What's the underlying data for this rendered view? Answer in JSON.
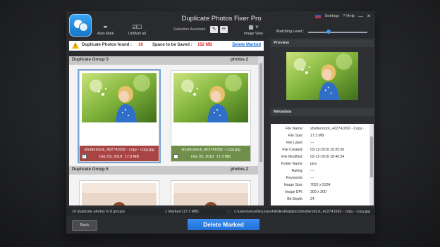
{
  "app": {
    "title": "Duplicate Photos Fixer Pro"
  },
  "topbar": {
    "settings": "Settings",
    "help": "? Help",
    "language": "EN"
  },
  "toolbar": {
    "auto_mark": "Auto Mark",
    "unmark_all": "UnMark all",
    "selection_assistant": "Selection Assistant",
    "image_view": "Image View",
    "matching_level": "Matching Level :"
  },
  "matching_level_fraction": 0.35,
  "info": {
    "found_label": "Duplicate Photos found :",
    "found_value": "16",
    "space_label": "Space to be Saved :",
    "space_value": "152 MB",
    "delete_link": "Delete Marked"
  },
  "groups": [
    {
      "name": "Duplicate Group 5",
      "count": "photos 2",
      "photos": [
        {
          "filename": "shutterstock_422741692 - copy - copy.jpg",
          "date": "Dec 03, 2019",
          "size": "17.3 MB",
          "checked": "✓",
          "status": "marked"
        },
        {
          "filename": "shutterstock_422741692 - copy.jpg",
          "date": "Dec 03, 2019",
          "size": "17.3 MB",
          "checked": "",
          "status": "kept"
        }
      ]
    },
    {
      "name": "Duplicate Group 6",
      "count": "photos 2"
    }
  ],
  "panels": {
    "preview": "Preview",
    "metadata": "Metadata"
  },
  "metadata": [
    {
      "k": "File Name:",
      "v": "shutterstock_422741692 - Copy - Copy.jpg"
    },
    {
      "k": "File Size:",
      "v": "17.3 MB"
    },
    {
      "k": "File Label:",
      "v": "---"
    },
    {
      "k": "File Created:",
      "v": "03-12-2019 10:35:56"
    },
    {
      "k": "File Modified:",
      "v": "02-12-2019 18:46:34"
    },
    {
      "k": "Folder Name:",
      "v": "pics"
    },
    {
      "k": "Rating:",
      "v": "---"
    },
    {
      "k": "Keywords:",
      "v": "---"
    },
    {
      "k": "Image Size:",
      "v": "7652 x 5234"
    },
    {
      "k": "Image DPI:",
      "v": "300 x 300"
    },
    {
      "k": "Bit Depth:",
      "v": "24"
    }
  ],
  "status": {
    "groups": "16 duplicate photos in 8 groups",
    "marked": "1 Marked (17.3 MB)",
    "path": "c:\\users\\anushka.kaushik\\desktop\\pics\\shutterstock_422741692 - copy - copy.jpg"
  },
  "buttons": {
    "back": "Back",
    "delete_marked": "Delete Marked"
  },
  "colors": {
    "accent": "#1f6fd8",
    "marked": "#a94444",
    "kept": "#6f8f4a",
    "warning": "#f0b400"
  }
}
